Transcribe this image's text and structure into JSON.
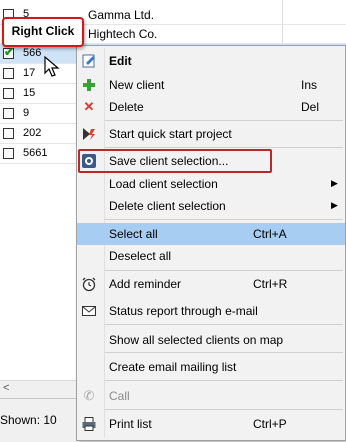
{
  "grid": {
    "rows": [
      {
        "id": "5",
        "name": "Gamma Ltd.",
        "checked": false,
        "selected": false
      },
      {
        "id": "",
        "name": "Hightech Co.",
        "checked": false,
        "selected": false
      },
      {
        "id": "566",
        "name": "",
        "checked": true,
        "selected": true
      },
      {
        "id": "17",
        "name": "",
        "checked": false,
        "selected": false
      },
      {
        "id": "15",
        "name": "",
        "checked": false,
        "selected": false
      },
      {
        "id": "9",
        "name": "",
        "checked": false,
        "selected": false
      },
      {
        "id": "202",
        "name": "",
        "checked": false,
        "selected": false
      },
      {
        "id": "5661",
        "name": "",
        "checked": false,
        "selected": false
      }
    ]
  },
  "callout": {
    "label": "Right Click"
  },
  "footer": {
    "shown": "Shown: 10",
    "scroll_left": "<"
  },
  "menu": {
    "edit": "Edit",
    "new_client": "New client",
    "new_client_sc": "Ins",
    "delete": "Delete",
    "delete_sc": "Del",
    "quick_start": "Start quick start project",
    "save_selection": "Save client selection...",
    "load_selection": "Load client selection",
    "delete_selection": "Delete client selection",
    "select_all": "Select all",
    "select_all_sc": "Ctrl+A",
    "deselect_all": "Deselect all",
    "add_reminder": "Add reminder",
    "add_reminder_sc": "Ctrl+R",
    "status_report": "Status report through e-mail",
    "show_on_map": "Show all selected clients on map",
    "create_mailing": "Create email mailing list",
    "call": "Call",
    "print_list": "Print list",
    "print_list_sc": "Ctrl+P",
    "submenu_arrow": "▶"
  },
  "colors": {
    "highlight": "#a8cdf2",
    "callout_border": "#d01a1a"
  }
}
